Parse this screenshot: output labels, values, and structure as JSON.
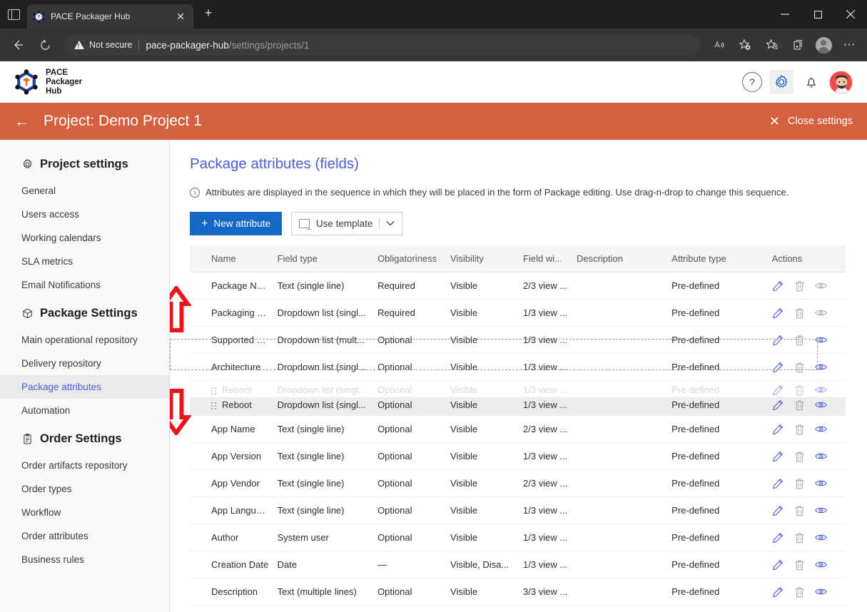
{
  "browser": {
    "tab": {
      "title": "PACE Packager Hub",
      "favicon": "pace-cube-icon",
      "close": "✕"
    },
    "newtab_label": "+",
    "window_controls": {
      "minimize": "─",
      "maximize": "☐",
      "close": "✕"
    },
    "toolbar": {
      "back": "←",
      "reload": "↻",
      "security_label": "Not secure",
      "url_domain": "pace-packager-hub",
      "url_path": "/settings/projects/1",
      "read_aloud": "A",
      "add_favorite": "add-favorite-icon",
      "favorites": "favorites-icon",
      "collections": "collections-icon",
      "profile": "profile-icon",
      "settings_more": "⋯"
    }
  },
  "app_header": {
    "logo_lines": [
      "PACE",
      "Packager",
      "Hub"
    ],
    "help_label": "?",
    "gear_label": "gear-icon",
    "bell_label": "bell-icon",
    "avatar_label": "user-avatar"
  },
  "project_bar": {
    "back": "←",
    "title": "Project: Demo Project 1",
    "close_settings": "Close settings",
    "close_icon": "✕",
    "accent_color": "#d4603f"
  },
  "sidebar": {
    "groups": [
      {
        "label": "Project settings",
        "icon": "gear-icon",
        "items": [
          {
            "label": "General",
            "active": false
          },
          {
            "label": "Users access",
            "active": false
          },
          {
            "label": "Working calendars",
            "active": false
          },
          {
            "label": "SLA metrics",
            "active": false
          },
          {
            "label": "Email Notifications",
            "active": false
          }
        ]
      },
      {
        "label": "Package Settings",
        "icon": "package-icon",
        "items": [
          {
            "label": "Main operational repository",
            "active": false
          },
          {
            "label": "Delivery repository",
            "active": false
          },
          {
            "label": "Package attributes",
            "active": true
          },
          {
            "label": "Automation",
            "active": false
          }
        ]
      },
      {
        "label": "Order Settings",
        "icon": "clipboard-icon",
        "items": [
          {
            "label": "Order artifacts repository",
            "active": false
          },
          {
            "label": "Order types",
            "active": false
          },
          {
            "label": "Workflow",
            "active": false
          },
          {
            "label": "Order attributes",
            "active": false
          },
          {
            "label": "Business rules",
            "active": false
          }
        ]
      }
    ]
  },
  "main": {
    "title": "Package attributes (fields)",
    "notice": "Attributes are displayed in the sequence in which they will be placed in the form of Package editing. Use drag-n-drop to change this sequence.",
    "notice_icon": "info-icon",
    "new_attribute_label": "New attribute",
    "new_attribute_plus": "+",
    "use_template_label": "Use template",
    "use_template_chevron": "⌄",
    "table": {
      "columns": [
        "Name",
        "Field type",
        "Obligatoriness",
        "Visibility",
        "Field wi...",
        "Description",
        "Attribute type",
        "Actions"
      ],
      "rows": [
        {
          "name": "Package Name",
          "type": "Text (single line)",
          "obligatoriness": "Required",
          "visibility": "Visible",
          "width": "2/3 view ...",
          "description": "",
          "attribute_type": "Pre-defined",
          "eye_active": false
        },
        {
          "name": "Packaging Tech...",
          "type": "Dropdown list (singl...",
          "obligatoriness": "Required",
          "visibility": "Visible",
          "width": "1/3 view ...",
          "description": "",
          "attribute_type": "Pre-defined",
          "eye_active": false
        },
        {
          "name": "Supported OS",
          "type": "Dropdown list (mult...",
          "obligatoriness": "Optional",
          "visibility": "Visible",
          "width": "1/3 view ...",
          "description": "",
          "attribute_type": "Pre-defined",
          "eye_active": true
        },
        {
          "name": "Architecture",
          "type": "Dropdown list (singl...",
          "obligatoriness": "Optional",
          "visibility": "Visible",
          "width": "1/3 view ...",
          "description": "",
          "attribute_type": "Pre-defined",
          "eye_active": true
        },
        {
          "name": "App Name",
          "type": "Text (single line)",
          "obligatoriness": "Optional",
          "visibility": "Visible",
          "width": "2/3 view ...",
          "description": "",
          "attribute_type": "Pre-defined",
          "eye_active": true
        },
        {
          "name": "App Version",
          "type": "Text (single line)",
          "obligatoriness": "Optional",
          "visibility": "Visible",
          "width": "1/3 view ...",
          "description": "",
          "attribute_type": "Pre-defined",
          "eye_active": true
        },
        {
          "name": "App Vendor",
          "type": "Text (single line)",
          "obligatoriness": "Optional",
          "visibility": "Visible",
          "width": "2/3 view ...",
          "description": "",
          "attribute_type": "Pre-defined",
          "eye_active": true
        },
        {
          "name": "App Language",
          "type": "Text (single line)",
          "obligatoriness": "Optional",
          "visibility": "Visible",
          "width": "1/3 view ...",
          "description": "",
          "attribute_type": "Pre-defined",
          "eye_active": true
        },
        {
          "name": "Author",
          "type": "System user",
          "obligatoriness": "Optional",
          "visibility": "Visible",
          "width": "1/3 view ...",
          "description": "",
          "attribute_type": "Pre-defined",
          "eye_active": true
        },
        {
          "name": "Creation Date",
          "type": "Date",
          "obligatoriness": "—",
          "visibility": "Visible, Disa...",
          "width": "1/3 view ...",
          "description": "",
          "attribute_type": "Pre-defined",
          "eye_active": true
        },
        {
          "name": "Description",
          "type": "Text (multiple lines)",
          "obligatoriness": "Optional",
          "visibility": "Visible",
          "width": "3/3 view ...",
          "description": "",
          "attribute_type": "Pre-defined",
          "eye_active": true
        }
      ],
      "dragging": {
        "ghost": {
          "name": "Reboot",
          "type": "Dropdown list (singl...",
          "obligatoriness": "Optional",
          "visibility": "Visible",
          "width": "1/3 view ...",
          "description": "",
          "attribute_type": "Pre-defined"
        },
        "active": {
          "name": "Reboot",
          "type": "Dropdown list (singl...",
          "obligatoriness": "Optional",
          "visibility": "Visible",
          "width": "1/3 view ...",
          "description": "",
          "attribute_type": "Pre-defined"
        },
        "inserted_after": "Architecture"
      },
      "action_icons": [
        "edit-pencil-icon",
        "delete-trash-icon",
        "visibility-eye-icon"
      ]
    }
  },
  "annotations": {
    "arrow_up": {
      "color": "#e8161b",
      "direction": "up"
    },
    "arrow_down": {
      "color": "#e8161b",
      "direction": "down"
    }
  }
}
